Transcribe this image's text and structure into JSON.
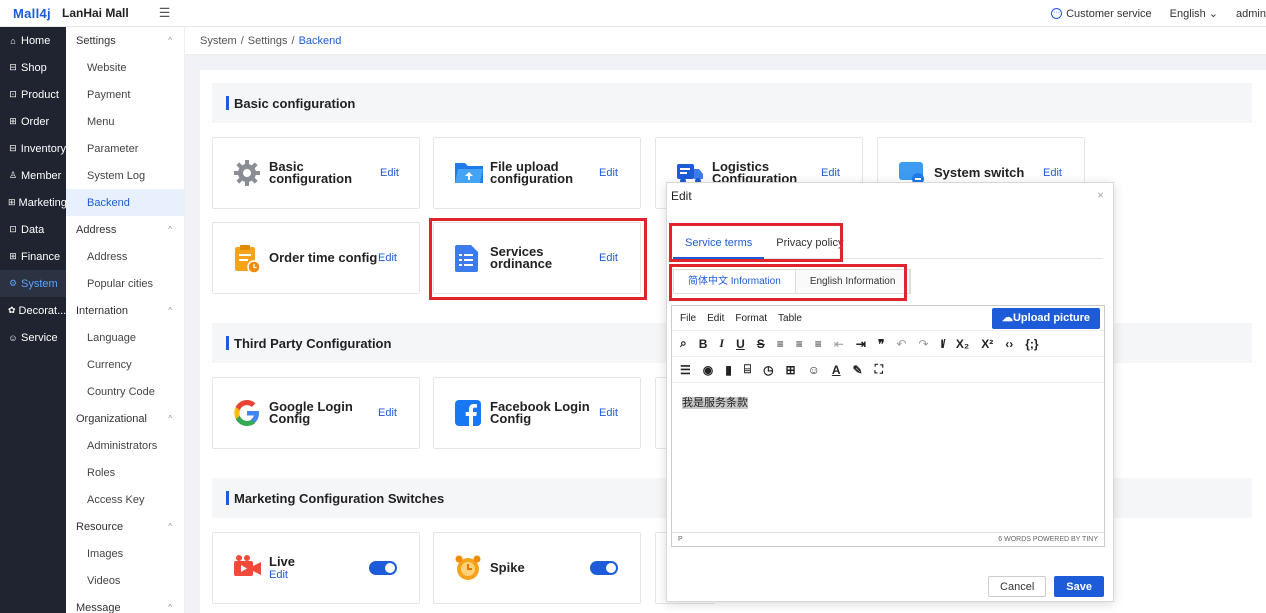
{
  "header": {
    "logo": "Mall4j",
    "mall_name": "LanHai Mall",
    "customer_service": "Customer service",
    "language": "English",
    "user": "admin"
  },
  "sidebar": [
    {
      "label": "Home",
      "icon": "home-icon"
    },
    {
      "label": "Shop",
      "icon": "shop-icon"
    },
    {
      "label": "Product",
      "icon": "product-icon"
    },
    {
      "label": "Order",
      "icon": "order-icon"
    },
    {
      "label": "Inventory",
      "icon": "inventory-icon"
    },
    {
      "label": "Member",
      "icon": "member-icon"
    },
    {
      "label": "Marketing",
      "icon": "marketing-icon"
    },
    {
      "label": "Data",
      "icon": "data-icon"
    },
    {
      "label": "Finance",
      "icon": "finance-icon"
    },
    {
      "label": "System",
      "icon": "system-icon",
      "active": true
    },
    {
      "label": "Decorat...",
      "icon": "decoration-icon"
    },
    {
      "label": "Service",
      "icon": "service-icon"
    }
  ],
  "submenu": [
    {
      "type": "group",
      "label": "Settings"
    },
    {
      "type": "item",
      "label": "Website"
    },
    {
      "type": "item",
      "label": "Payment"
    },
    {
      "type": "item",
      "label": "Menu"
    },
    {
      "type": "item",
      "label": "Parameter"
    },
    {
      "type": "item",
      "label": "System Log"
    },
    {
      "type": "item",
      "label": "Backend",
      "active": true
    },
    {
      "type": "group",
      "label": "Address"
    },
    {
      "type": "item",
      "label": "Address"
    },
    {
      "type": "item",
      "label": "Popular cities"
    },
    {
      "type": "group",
      "label": "Internation"
    },
    {
      "type": "item",
      "label": "Language"
    },
    {
      "type": "item",
      "label": "Currency"
    },
    {
      "type": "item",
      "label": "Country Code"
    },
    {
      "type": "group",
      "label": "Organizational"
    },
    {
      "type": "item",
      "label": "Administrators"
    },
    {
      "type": "item",
      "label": "Roles"
    },
    {
      "type": "item",
      "label": "Access Key"
    },
    {
      "type": "group",
      "label": "Resource"
    },
    {
      "type": "item",
      "label": "Images"
    },
    {
      "type": "item",
      "label": "Videos"
    },
    {
      "type": "group",
      "label": "Message"
    }
  ],
  "breadcrumb": {
    "a": "System",
    "b": "Settings",
    "c": "Backend",
    "sep": "/"
  },
  "sections": {
    "basic": "Basic configuration",
    "third": "Third Party Configuration",
    "marketing": "Marketing Configuration Switches"
  },
  "cards": {
    "basic_config": {
      "title": "Basic configuration",
      "edit": "Edit"
    },
    "file_upload": {
      "title1": "File upload",
      "title2": "configuration",
      "edit": "Edit"
    },
    "logistics": {
      "title1": "Logistics",
      "title2": "Configuration",
      "edit": "Edit"
    },
    "system_switch": {
      "title": "System switch",
      "edit": "Edit"
    },
    "order_time": {
      "title": "Order time config",
      "edit": "Edit"
    },
    "services": {
      "title": "Services ordinance",
      "edit": "Edit"
    },
    "google": {
      "title1": "Google Login",
      "title2": "Config",
      "edit": "Edit"
    },
    "facebook": {
      "title1": "Facebook Login",
      "title2": "Config",
      "edit": "Edit"
    },
    "live": {
      "title": "Live",
      "edit": "Edit",
      "enabled": true
    },
    "spike": {
      "title": "Spike",
      "enabled": true
    }
  },
  "modal": {
    "title": "Edit",
    "close": "×",
    "tabs": [
      "Service terms",
      "Privacy policy"
    ],
    "lang_tabs": [
      "简体中文 Information",
      "English Information"
    ],
    "menubar": [
      "File",
      "Edit",
      "Format",
      "Table"
    ],
    "upload": "Upload picture",
    "content": "我是服务条款",
    "status_left": "P",
    "status_right": "6 WORDS  POWERED BY TINY",
    "cancel": "Cancel",
    "save": "Save"
  },
  "colors": {
    "accent": "#1e5bd8",
    "highlight": "#e0242e",
    "sidebar_bg": "#1f2430"
  }
}
